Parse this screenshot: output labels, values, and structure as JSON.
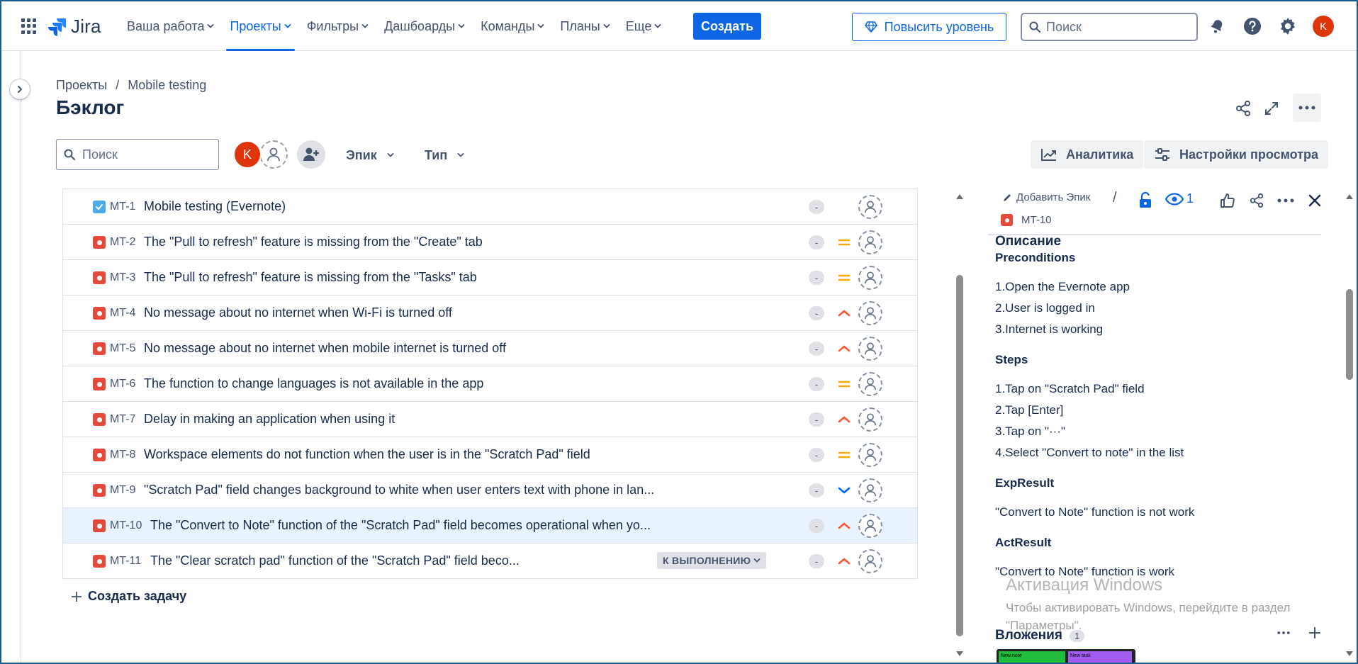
{
  "app": {
    "logo_text": "Jira"
  },
  "nav": {
    "items": [
      {
        "label": "Ваша работа",
        "active": false
      },
      {
        "label": "Проекты",
        "active": true
      },
      {
        "label": "Фильтры",
        "active": false
      },
      {
        "label": "Дашбоарды",
        "active": false
      },
      {
        "label": "Команды",
        "active": false
      },
      {
        "label": "Планы",
        "active": false
      },
      {
        "label": "Еще",
        "active": false
      }
    ],
    "create_label": "Создать",
    "upgrade_label": "Повысить уровень",
    "search_placeholder": "Поиск",
    "avatar_initial": "K"
  },
  "header": {
    "breadcrumb": [
      "Проекты",
      "Mobile testing"
    ],
    "breadcrumb_sep": "/",
    "title": "Бэклог"
  },
  "filters": {
    "search_placeholder": "Поиск",
    "avatar_initial": "K",
    "epic_label": "Эпик",
    "type_label": "Тип",
    "analytics_label": "Аналитика",
    "view_settings_label": "Настройки просмотра"
  },
  "issues": [
    {
      "key": "MT-1",
      "type": "task",
      "summary": "Mobile testing (Evernote)",
      "estimate": "-",
      "priority": "none"
    },
    {
      "key": "MT-2",
      "type": "bug",
      "summary": "The \"Pull to refresh\" feature is missing from the \"Create\" tab",
      "estimate": "-",
      "priority": "medium"
    },
    {
      "key": "MT-3",
      "type": "bug",
      "summary": "The \"Pull to refresh\" feature is missing from the \"Tasks\" tab",
      "estimate": "-",
      "priority": "medium"
    },
    {
      "key": "MT-4",
      "type": "bug",
      "summary": "No message about no internet when Wi-Fi is turned off",
      "estimate": "-",
      "priority": "high"
    },
    {
      "key": "MT-5",
      "type": "bug",
      "summary": "No message about no internet when mobile internet is turned off",
      "estimate": "-",
      "priority": "high"
    },
    {
      "key": "MT-6",
      "type": "bug",
      "summary": "The function to change languages is not available in the app",
      "estimate": "-",
      "priority": "medium"
    },
    {
      "key": "MT-7",
      "type": "bug",
      "summary": "Delay in making an application when using it",
      "estimate": "-",
      "priority": "high"
    },
    {
      "key": "MT-8",
      "type": "bug",
      "summary": "Workspace elements do not function when the user is in the \"Scratch Pad\" field",
      "estimate": "-",
      "priority": "medium"
    },
    {
      "key": "MT-9",
      "type": "bug",
      "summary": "\"Scratch Pad\" field changes background to white when user enters text with phone in lan...",
      "estimate": "-",
      "priority": "low"
    },
    {
      "key": "MT-10",
      "type": "bug",
      "summary": "The \"Convert to Note\" function of the \"Scratch Pad\" field becomes operational when yo...",
      "estimate": "-",
      "priority": "high",
      "selected": true
    },
    {
      "key": "MT-11",
      "type": "bug",
      "summary": "The \"Clear scratch pad\" function of the \"Scratch Pad\" field beco...",
      "estimate": "-",
      "priority": "high",
      "status": "К ВЫПОЛНЕНИЮ"
    }
  ],
  "create_task_label": "Создать задачу",
  "detail": {
    "add_epic_label": "Добавить Эпик",
    "slash": "/",
    "watchers": "1",
    "key": "MT-10",
    "description_heading": "Описание",
    "sections": [
      {
        "title": "Preconditions",
        "lines": [
          "1.Open the Evernote app",
          "2.User is logged in",
          "3.Internet is working"
        ]
      },
      {
        "title": "Steps",
        "lines": [
          "1.Tap on \"Scratch Pad\" field",
          "2.Tap [Enter]",
          "3.Tap on \"···\"",
          "4.Select \"Convert to note\" in the list"
        ]
      },
      {
        "title": "ExpResult",
        "lines": [
          "\"Convert to Note\" function is not work"
        ]
      },
      {
        "title": "ActResult",
        "lines": [
          "\"Convert to Note\" function is work"
        ]
      }
    ],
    "attachments_label": "Вложения",
    "attachments_count": "1",
    "thumb_labels": [
      "New note",
      "New task"
    ]
  },
  "watermark": {
    "title": "Активация Windows",
    "text": "Чтобы активировать Windows, перейдите в раздел \"Параметры\"."
  },
  "colors": {
    "brand_blue": "#0c66e4",
    "bug_red": "#e5493a",
    "task_blue": "#4bade8",
    "prio_medium": "#ffab00",
    "prio_high": "#ff5630",
    "prio_low": "#0065ff",
    "selected_row": "#e9f2ff"
  }
}
